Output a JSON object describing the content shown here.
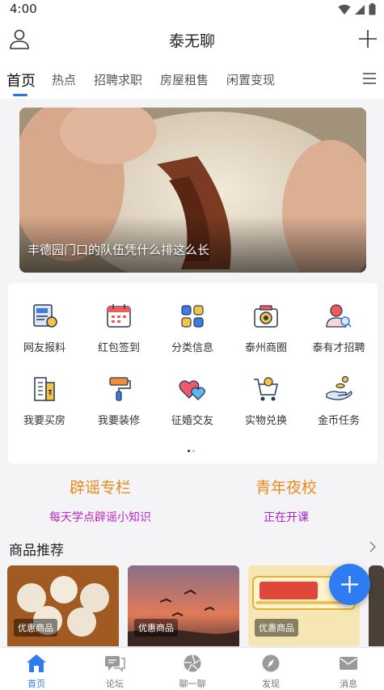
{
  "status_bar": {
    "time": "4:00"
  },
  "header": {
    "title": "泰无聊"
  },
  "tabs": [
    {
      "label": "首页",
      "active": true
    },
    {
      "label": "热点"
    },
    {
      "label": "招聘求职"
    },
    {
      "label": "房屋租售"
    },
    {
      "label": "闲置变现"
    }
  ],
  "banner": {
    "caption": "丰德园门口的队伍凭什么排这么长"
  },
  "grid": [
    {
      "label": "网友报料",
      "icon": "news-icon"
    },
    {
      "label": "红包签到",
      "icon": "calendar-icon"
    },
    {
      "label": "分类信息",
      "icon": "category-icon"
    },
    {
      "label": "泰州商圈",
      "icon": "camera-icon"
    },
    {
      "label": "泰有才招聘",
      "icon": "recruit-icon"
    },
    {
      "label": "我要买房",
      "icon": "building-icon"
    },
    {
      "label": "我要装修",
      "icon": "paint-roller-icon"
    },
    {
      "label": "征婚交友",
      "icon": "hearts-icon"
    },
    {
      "label": "实物兑换",
      "icon": "cart-icon"
    },
    {
      "label": "金币任务",
      "icon": "coin-hand-icon"
    }
  ],
  "promos": [
    {
      "title": "辟谣专栏",
      "subtitle": "每天学点辟谣小知识"
    },
    {
      "title": "青年夜校",
      "subtitle": "正在开课"
    }
  ],
  "products": {
    "title": "商品推荐",
    "badge": "优惠商品"
  },
  "bottom_nav": [
    {
      "label": "首页",
      "active": true
    },
    {
      "label": "论坛"
    },
    {
      "label": "聊一聊"
    },
    {
      "label": "发现"
    },
    {
      "label": "消息"
    }
  ],
  "colors": {
    "accent": "#2f7cf2",
    "promo_title": "#e88b1e",
    "promo_sub": "#c026c8"
  }
}
